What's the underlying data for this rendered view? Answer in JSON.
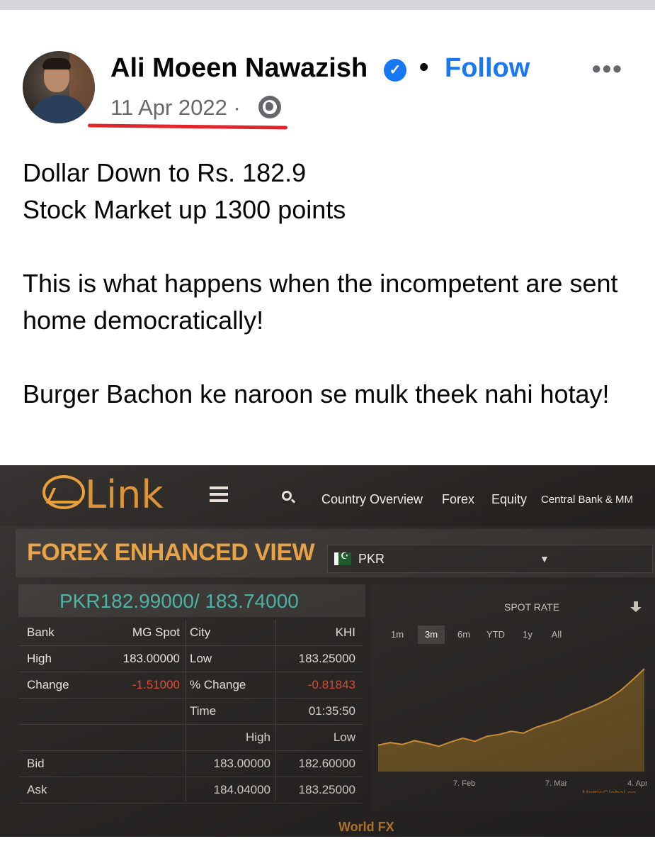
{
  "post": {
    "author": "Ali Moeen Nawazish",
    "separator": "•",
    "follow_label": "Follow",
    "more_label": "•••",
    "date": "11 Apr 2022 ·",
    "paragraphs": [
      "Dollar Down to Rs. 182.9\nStock Market up 1300 points",
      "This is what happens when the incompetent are sent home democratically!",
      "Burger Bachon ke naroon se mulk theek nahi hotay!"
    ]
  },
  "screen": {
    "logo_text": "Link",
    "nav": [
      "Country Overview",
      "Forex",
      "Equity",
      "Central Bank & MM"
    ],
    "forex_title": "FOREX ENHANCED VIEW",
    "currency": "PKR",
    "quote": "PKR182.99000/ 183.74000",
    "table": {
      "rows": [
        [
          "Bank",
          "MG Spot",
          "City",
          "KHI"
        ],
        [
          "High",
          "183.00000",
          "Low",
          "183.25000"
        ],
        [
          "Change",
          "-1.51000",
          "% Change",
          "-0.81843"
        ],
        [
          "",
          "",
          "Time",
          "01:35:50"
        ],
        [
          "",
          "",
          "High",
          "Low"
        ],
        [
          "Bid",
          "",
          "183.00000",
          "182.60000"
        ],
        [
          "Ask",
          "",
          "184.04000",
          "183.25000"
        ]
      ]
    },
    "spot_rate_label": "SPOT RATE",
    "ranges": [
      "1m",
      "3m",
      "6m",
      "YTD",
      "1y",
      "All"
    ],
    "active_range": "3m",
    "x_ticks": [
      "7. Feb",
      "7. Mar",
      "4. Apr"
    ],
    "watermark": "MettisGlobal.co",
    "footer": "World FX",
    "accent_color": "#e6a042",
    "quote_color": "#48b3a5",
    "negative_color": "#e0503c"
  },
  "chart_data": {
    "type": "area",
    "title": "SPOT RATE",
    "x": [
      "7. Feb",
      "7. Mar",
      "4. Apr"
    ],
    "series": [
      {
        "values": [
          176.2,
          176.6,
          176.3,
          176.9,
          176.5,
          176.0,
          176.7,
          177.3,
          176.8,
          177.6,
          177.9,
          178.4,
          178.1,
          179.0,
          179.6,
          180.2,
          181.1,
          181.8,
          182.6,
          183.5,
          184.8,
          186.5,
          188.3
        ]
      }
    ],
    "ylim": [
      172,
      190
    ],
    "grid": false,
    "legend": "none"
  }
}
